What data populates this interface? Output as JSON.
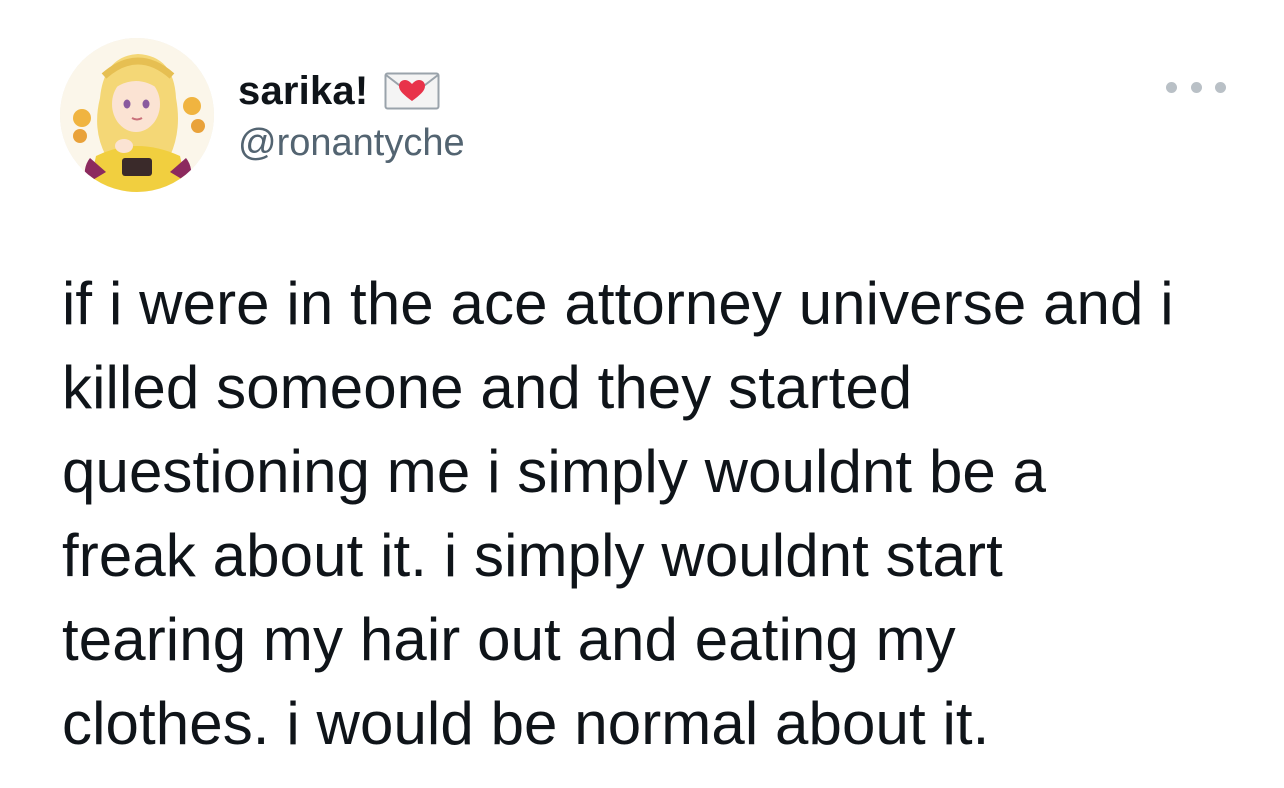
{
  "author": {
    "display_name": "sarika!",
    "handle": "@ronantyche",
    "name_emoji": "love-letter-icon",
    "avatar": "avatar"
  },
  "menu": {
    "icon": "more-options-icon"
  },
  "tweet": {
    "lines": [
      "if i were in the ace attorney universe and i",
      "killed someone and they started",
      "questioning me i simply wouldnt be a",
      "freak about it. i simply wouldnt start",
      "tearing my hair out and eating my",
      "clothes. i would be normal about it."
    ]
  },
  "colors": {
    "text": "#0f1419",
    "secondary": "#536471",
    "heart": "#e8334a",
    "dots": "#b9c0c6"
  }
}
